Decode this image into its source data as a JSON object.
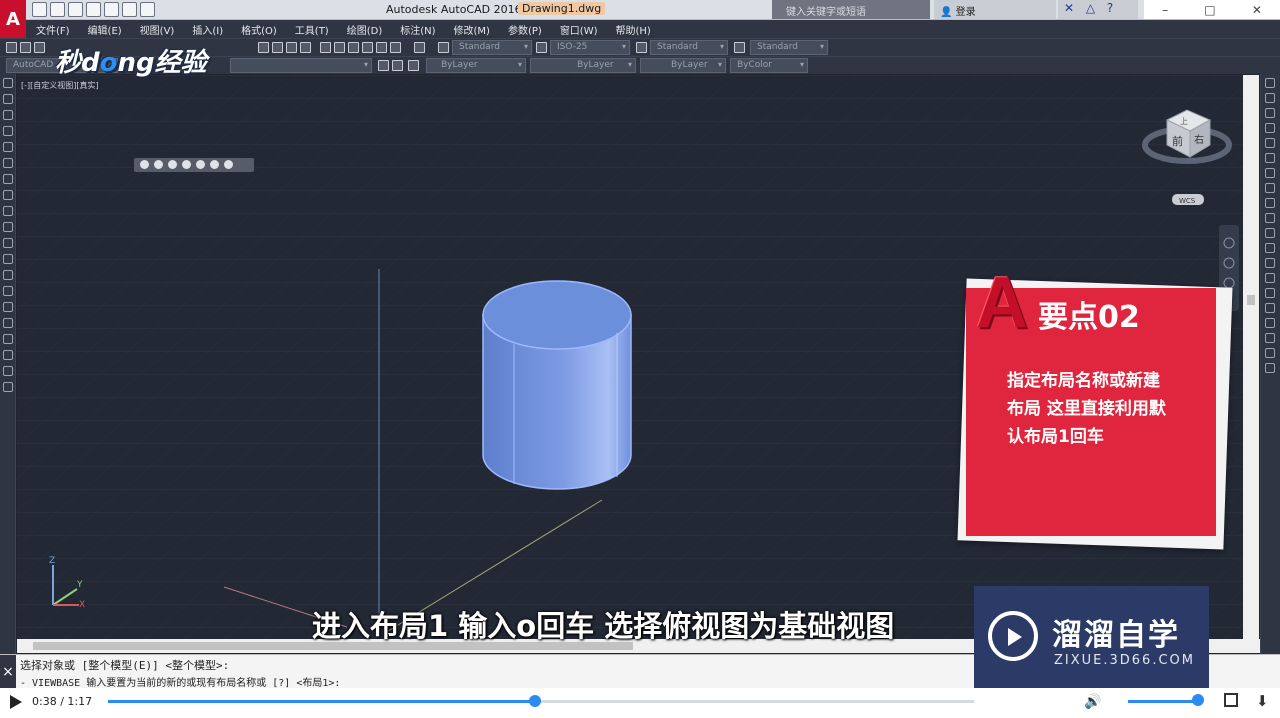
{
  "window": {
    "app_title": "Autodesk AutoCAD 2016",
    "file_name": "Drawing1.dwg",
    "search_placeholder": "键入关键字或短语",
    "signin_label": "登录",
    "app_logo": "A"
  },
  "menu": [
    "文件(F)",
    "编辑(E)",
    "视图(V)",
    "插入(I)",
    "格式(O)",
    "工具(T)",
    "绘图(D)",
    "标注(N)",
    "修改(M)",
    "参数(P)",
    "窗口(W)",
    "帮助(H)"
  ],
  "toolbar": {
    "text_style": "Standard",
    "dim_style": "ISO-25",
    "table_style": "Standard",
    "multileader_style": "Standard",
    "workspace": "AutoCAD",
    "layer_color": "ByLayer",
    "linetype": "ByLayer",
    "lineweight": "ByLayer",
    "plot_style": "ByColor"
  },
  "viewport": {
    "label": "[-][自定义视图][真实]",
    "viewcube_top_label": "上",
    "viewcube_front_label": "前",
    "viewcube_right_label": "右",
    "wcs_label": "WCS",
    "ucs_z": "Z",
    "ucs_y": "Y",
    "ucs_x": "X"
  },
  "command": {
    "line1": "选择对象或 [整个模型(E)] <整个模型>:",
    "line2": "- VIEWBASE 输入要置为当前的新的或现有布局名称或 [?] <布局1>:",
    "close_glyph": "×"
  },
  "watermark": {
    "brand_left_1": "秒d",
    "brand_left_o": "o",
    "brand_left_2": "ng经验",
    "brand_right": "溜溜自学",
    "brand_right_url": "ZIXUE.3D66.COM"
  },
  "callout": {
    "icon_letter": "A",
    "title": "要点02",
    "lines": [
      "指定布局名称或新建",
      "布局 这里直接利用默",
      "认布局1回车"
    ]
  },
  "subtitle": "进入布局1 输入o回车 选择俯视图为基础视图",
  "player": {
    "current_time": "0:38",
    "total_time": "1:17",
    "separator": " / ",
    "progress_fraction": 0.4935,
    "volume_fraction": 0.9,
    "accent_color": "#2a8cf0"
  },
  "colors": {
    "viewport_bg": "#222834",
    "cylinder_fill": "#6c8fdc",
    "cylinder_edge": "#9fb8ff",
    "card_red": "#e0263e"
  }
}
